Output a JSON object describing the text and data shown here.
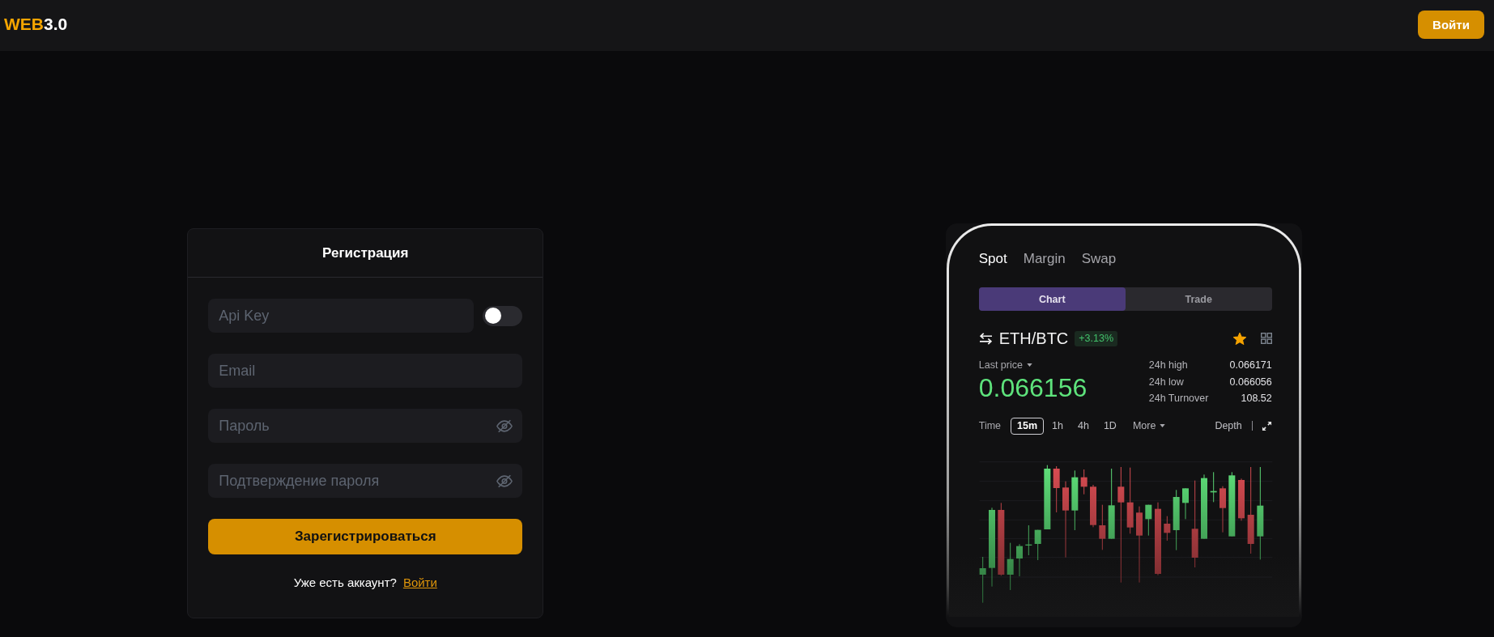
{
  "header": {
    "logo": {
      "accent": "WEB",
      "rest": "3.0"
    },
    "login_button": "Войти"
  },
  "registration": {
    "title": "Регистрация",
    "fields": [
      {
        "kind": "text",
        "placeholder": "Api Key",
        "switch": {
          "on": false
        }
      },
      {
        "kind": "text",
        "placeholder": "Email"
      },
      {
        "kind": "password",
        "placeholder": "Пароль"
      },
      {
        "kind": "password",
        "placeholder": "Подтверждение пароля"
      }
    ],
    "submit": "Зарегистрироваться",
    "footer": {
      "prompt": "Уже есть аккаунт?",
      "link": "Войти"
    }
  },
  "preview": {
    "market_tabs": [
      {
        "label": "Spot",
        "selected": true
      },
      {
        "label": "Margin",
        "selected": false
      },
      {
        "label": "Swap",
        "selected": false
      }
    ],
    "view_tabs": [
      {
        "label": "Chart",
        "selected": true
      },
      {
        "label": "Trade",
        "selected": false
      }
    ],
    "pair": "ETH/BTC",
    "change": "+3.13%",
    "favorite": true,
    "last_price_label": "Last price",
    "last_price": "0.066156",
    "stats": [
      {
        "label": "24h high",
        "value": "0.066171"
      },
      {
        "label": "24h low",
        "value": "0.066056"
      },
      {
        "label": "24h Turnover",
        "value": "108.52"
      }
    ],
    "time_label": "Time",
    "intervals": [
      {
        "label": "15m",
        "selected": true
      },
      {
        "label": "1h",
        "selected": false
      },
      {
        "label": "4h",
        "selected": false
      },
      {
        "label": "1D",
        "selected": false
      }
    ],
    "more": "More",
    "depth": "Depth"
  }
}
